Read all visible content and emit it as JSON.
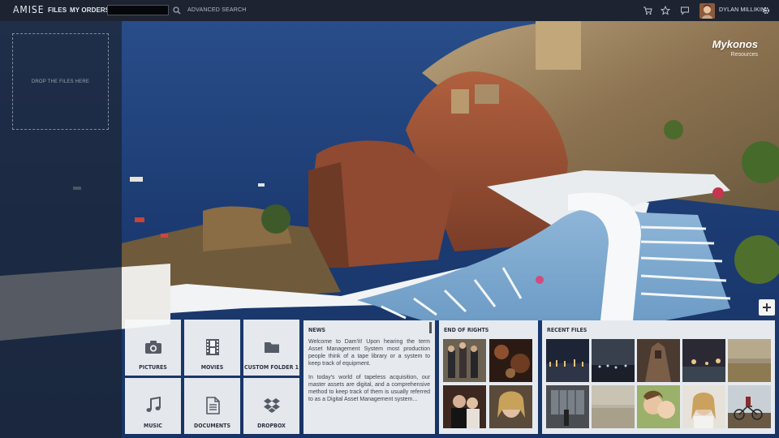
{
  "app": {
    "brand": "AMISE"
  },
  "nav": {
    "files": "FILES",
    "my_orders": "MY ORDERS"
  },
  "search": {
    "value": "",
    "placeholder": "",
    "advanced_label": "ADVANCED SEARCH"
  },
  "user": {
    "name": "DYLAN MILLIKIN"
  },
  "toolbar_icons": [
    "cart-icon",
    "star-icon",
    "chat-icon",
    "gear-icon"
  ],
  "left_panel": {
    "drop_label": "DROP THE FILES HERE"
  },
  "location": {
    "title": "Mykonos",
    "subtitle": "Resources"
  },
  "tiles": [
    {
      "label": "PICTURES",
      "icon": "camera-icon"
    },
    {
      "label": "MOVIES",
      "icon": "film-icon"
    },
    {
      "label": "CUSTOM FOLDER 1",
      "icon": "folder-icon"
    },
    {
      "label": "MUSIC",
      "icon": "music-note-icon"
    },
    {
      "label": "DOCUMENTS",
      "icon": "document-icon"
    },
    {
      "label": "DROPBOX",
      "icon": "dropbox-icon"
    }
  ],
  "news": {
    "title": "NEWS",
    "paragraphs": [
      "Welcome to Dam'it! Upon hearing the term Asset Management System most production people think of a tape library or a system to keep track of equipment.",
      "In today's world of tapeless acquisition, our master assets are digital, and a comprehensive method to keep track of them is usually referred to as a Digital Asset Management system..."
    ]
  },
  "end_of_rights": {
    "title": "END OF RIGHTS"
  },
  "recent_files": {
    "title": "RECENT FILES"
  },
  "colors": {
    "topbar": "#1d2330",
    "panel": "#f6f7f9",
    "sea": "#1f3f78",
    "text_dark": "#2d3340"
  }
}
